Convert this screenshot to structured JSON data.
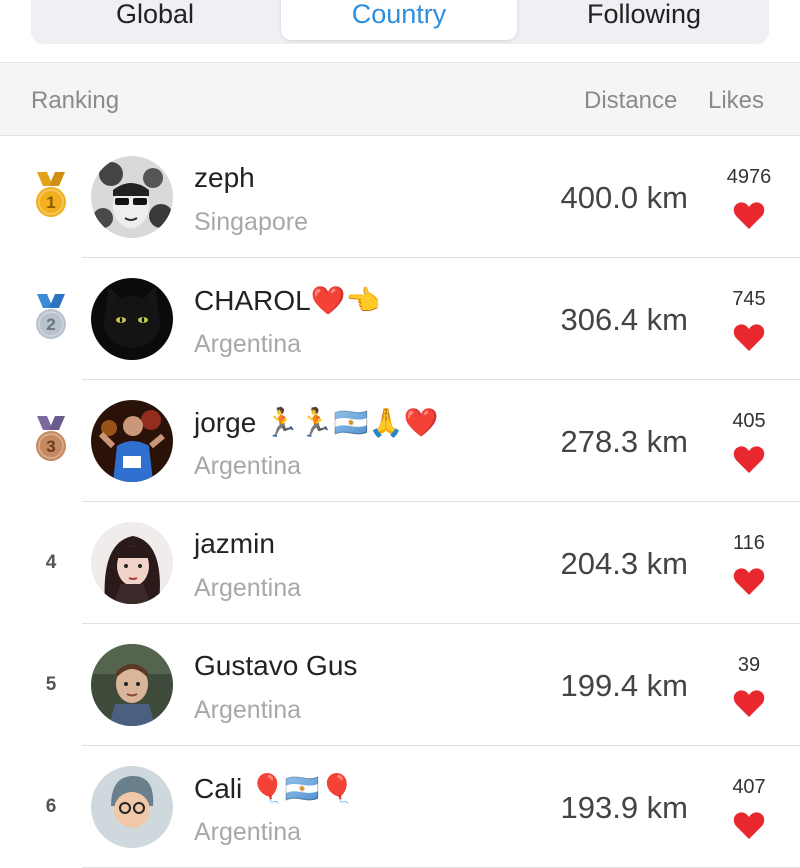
{
  "tabs": [
    {
      "label": "Global",
      "active": false
    },
    {
      "label": "Country",
      "active": true
    },
    {
      "label": "Following",
      "active": false
    }
  ],
  "header": {
    "ranking": "Ranking",
    "distance": "Distance",
    "likes": "Likes"
  },
  "colors": {
    "accent": "#2e8fe0",
    "heart": "#e8272f",
    "gold": "#f2b01e",
    "silver": "#b8c2cc",
    "bronze": "#c58a62"
  },
  "rows": [
    {
      "rank": "1",
      "medal": "gold",
      "name": "zeph",
      "country": "Singapore",
      "distance": "400.0 km",
      "likes": "4976",
      "avatar_icon": "sketch-portrait-avatar"
    },
    {
      "rank": "2",
      "medal": "silver",
      "name": "CHAROL❤️👈",
      "country": "Argentina",
      "distance": "306.4 km",
      "likes": "745",
      "avatar_icon": "black-cat-avatar"
    },
    {
      "rank": "3",
      "medal": "bronze",
      "name": "jorge 🏃🏃🇦🇷🙏❤️",
      "country": "Argentina",
      "distance": "278.3 km",
      "likes": "405",
      "avatar_icon": "runner-avatar"
    },
    {
      "rank": "4",
      "medal": null,
      "name": "jazmin",
      "country": "Argentina",
      "distance": "204.3 km",
      "likes": "116",
      "avatar_icon": "girl-portrait-avatar"
    },
    {
      "rank": "5",
      "medal": null,
      "name": "Gustavo Gus",
      "country": "Argentina",
      "distance": "199.4 km",
      "likes": "39",
      "avatar_icon": "child-portrait-avatar"
    },
    {
      "rank": "6",
      "medal": null,
      "name": "Cali 🎈🇦🇷🎈",
      "country": "Argentina",
      "distance": "193.9 km",
      "likes": "407",
      "avatar_icon": "cartoon-avatar"
    }
  ]
}
